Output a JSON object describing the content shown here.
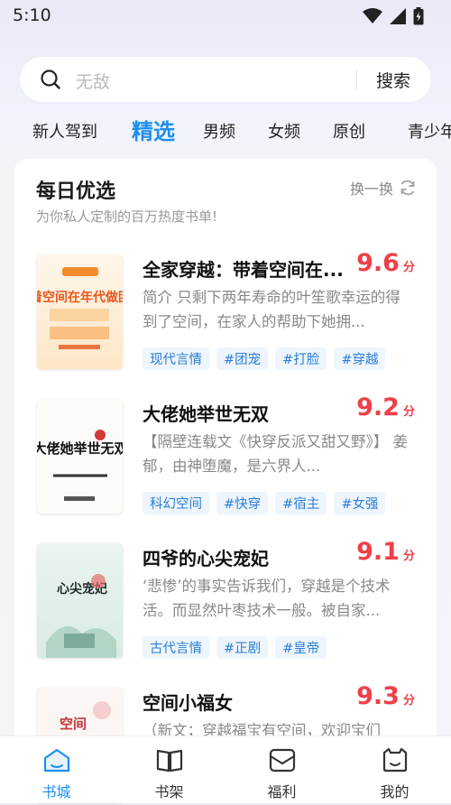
{
  "status": {
    "time": "5:10"
  },
  "search": {
    "placeholder": "无敌",
    "button": "搜索"
  },
  "tabs": [
    {
      "label": "新人驾到"
    },
    {
      "label": "精选",
      "active": true
    },
    {
      "label": "男频"
    },
    {
      "label": "女频"
    },
    {
      "label": "原创"
    },
    {
      "label": "青少年"
    }
  ],
  "daily": {
    "title": "每日优选",
    "subtitle": "为你私人定制的百万热度书单!",
    "refresh": "换一换",
    "books": [
      {
        "title": "全家穿越：带着空间在...",
        "score": "9.6",
        "unit": "分",
        "desc": "简介 只剩下两年寿命的叶笙歌幸运的得到了空间，在家人的帮助下她拥...",
        "tags": [
          "现代言情",
          "#团宠",
          "#打脸",
          "#穿越"
        ],
        "cover_text": "带着空间在年代做团宠"
      },
      {
        "title": "大佬她举世无双",
        "score": "9.2",
        "unit": "分",
        "desc": "【隔壁连载文《快穿反派又甜又野》】 姜郁，由神堕魔，是六界人...",
        "tags": [
          "科幻空间",
          "#快穿",
          "#宿主",
          "#女强"
        ],
        "cover_text": "大佬她举世无双"
      },
      {
        "title": "四爷的心尖宠妃",
        "score": "9.1",
        "unit": "分",
        "desc": "‘悲惨’的事实告诉我们，穿越是个技术活。而显然叶枣技术一般。被自家...",
        "tags": [
          "古代言情",
          "#正剧",
          "#皇帝"
        ],
        "cover_text": "心尖宠妃"
      },
      {
        "title": "空间小福女",
        "score": "9.3",
        "unit": "分",
        "desc": "（新文；穿越福宝有空间，欢迎宝们",
        "tags": [],
        "cover_text": "空间"
      }
    ]
  },
  "nav": [
    {
      "label": "书城",
      "icon": "bookstore-icon",
      "active": true
    },
    {
      "label": "书架",
      "icon": "bookshelf-icon"
    },
    {
      "label": "福利",
      "icon": "gift-icon"
    },
    {
      "label": "我的",
      "icon": "profile-icon"
    }
  ],
  "colors": {
    "accent": "#1d8ff0",
    "score": "#ef3f48",
    "tag_text": "#2a7ed6",
    "tag_bg": "#eef5fd"
  }
}
